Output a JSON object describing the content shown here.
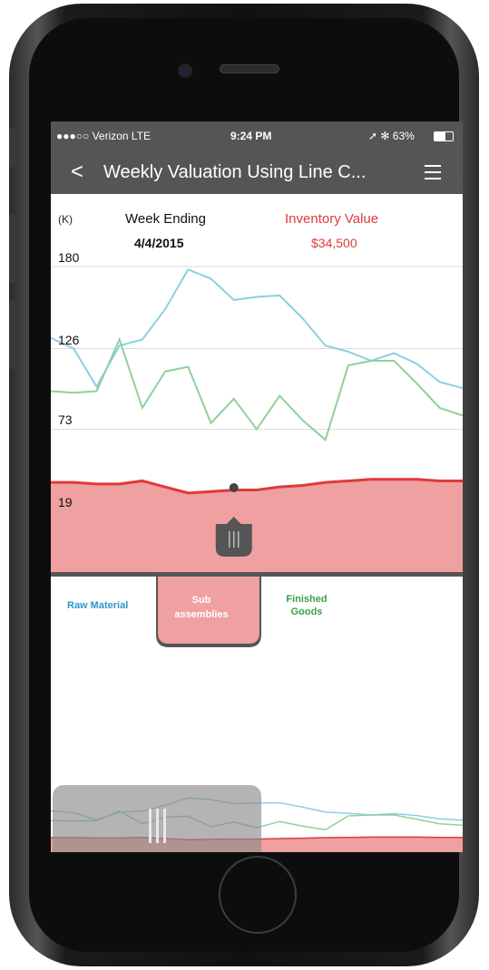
{
  "status_bar": {
    "carrier": "●●●○○ Verizon  LTE",
    "time": "9:24 PM",
    "battery": "➚ ✻ 63%"
  },
  "nav": {
    "title": "Weekly Valuation Using Line C...",
    "back_icon": "chevron-left-icon",
    "menu_icon": "hamburger-menu-icon"
  },
  "header": {
    "unit": "(K)",
    "week_label": "Week Ending",
    "week_date": "4/4/2015",
    "value_label": "Inventory Value",
    "value": "$34,500"
  },
  "legend": {
    "raw": "Raw Material",
    "sub": "Sub\nassemblies",
    "finished": "Finished\nGoods"
  },
  "colors": {
    "raw": "#8ccfe0",
    "sub": "#e03a3a",
    "sub_fill": "#efa0a0",
    "finished": "#8fd19b",
    "bar": "#555555"
  },
  "chart_data": {
    "type": "line",
    "yticks": [
      "180",
      "126",
      "73",
      "19"
    ],
    "ylim": [
      19,
      180
    ],
    "grid": true,
    "selected_week": "4/4/2015",
    "selected_value": 34.5,
    "series": [
      {
        "name": "Raw Material",
        "values": [
          133,
          126,
          101,
          128,
          132,
          152,
          178,
          172,
          158,
          160,
          161,
          146,
          128,
          124,
          118,
          123,
          116,
          104,
          100
        ]
      },
      {
        "name": "Sub assemblies",
        "values": [
          38,
          38,
          37,
          37,
          39,
          35,
          31,
          32,
          33,
          33,
          35,
          36,
          38,
          39,
          40,
          40,
          40,
          39,
          39
        ]
      },
      {
        "name": "Finished Goods",
        "values": [
          98,
          97,
          98,
          132,
          87,
          111,
          114,
          77,
          93,
          73,
          95,
          79,
          66,
          115,
          118,
          118,
          103,
          87,
          82
        ]
      }
    ]
  }
}
